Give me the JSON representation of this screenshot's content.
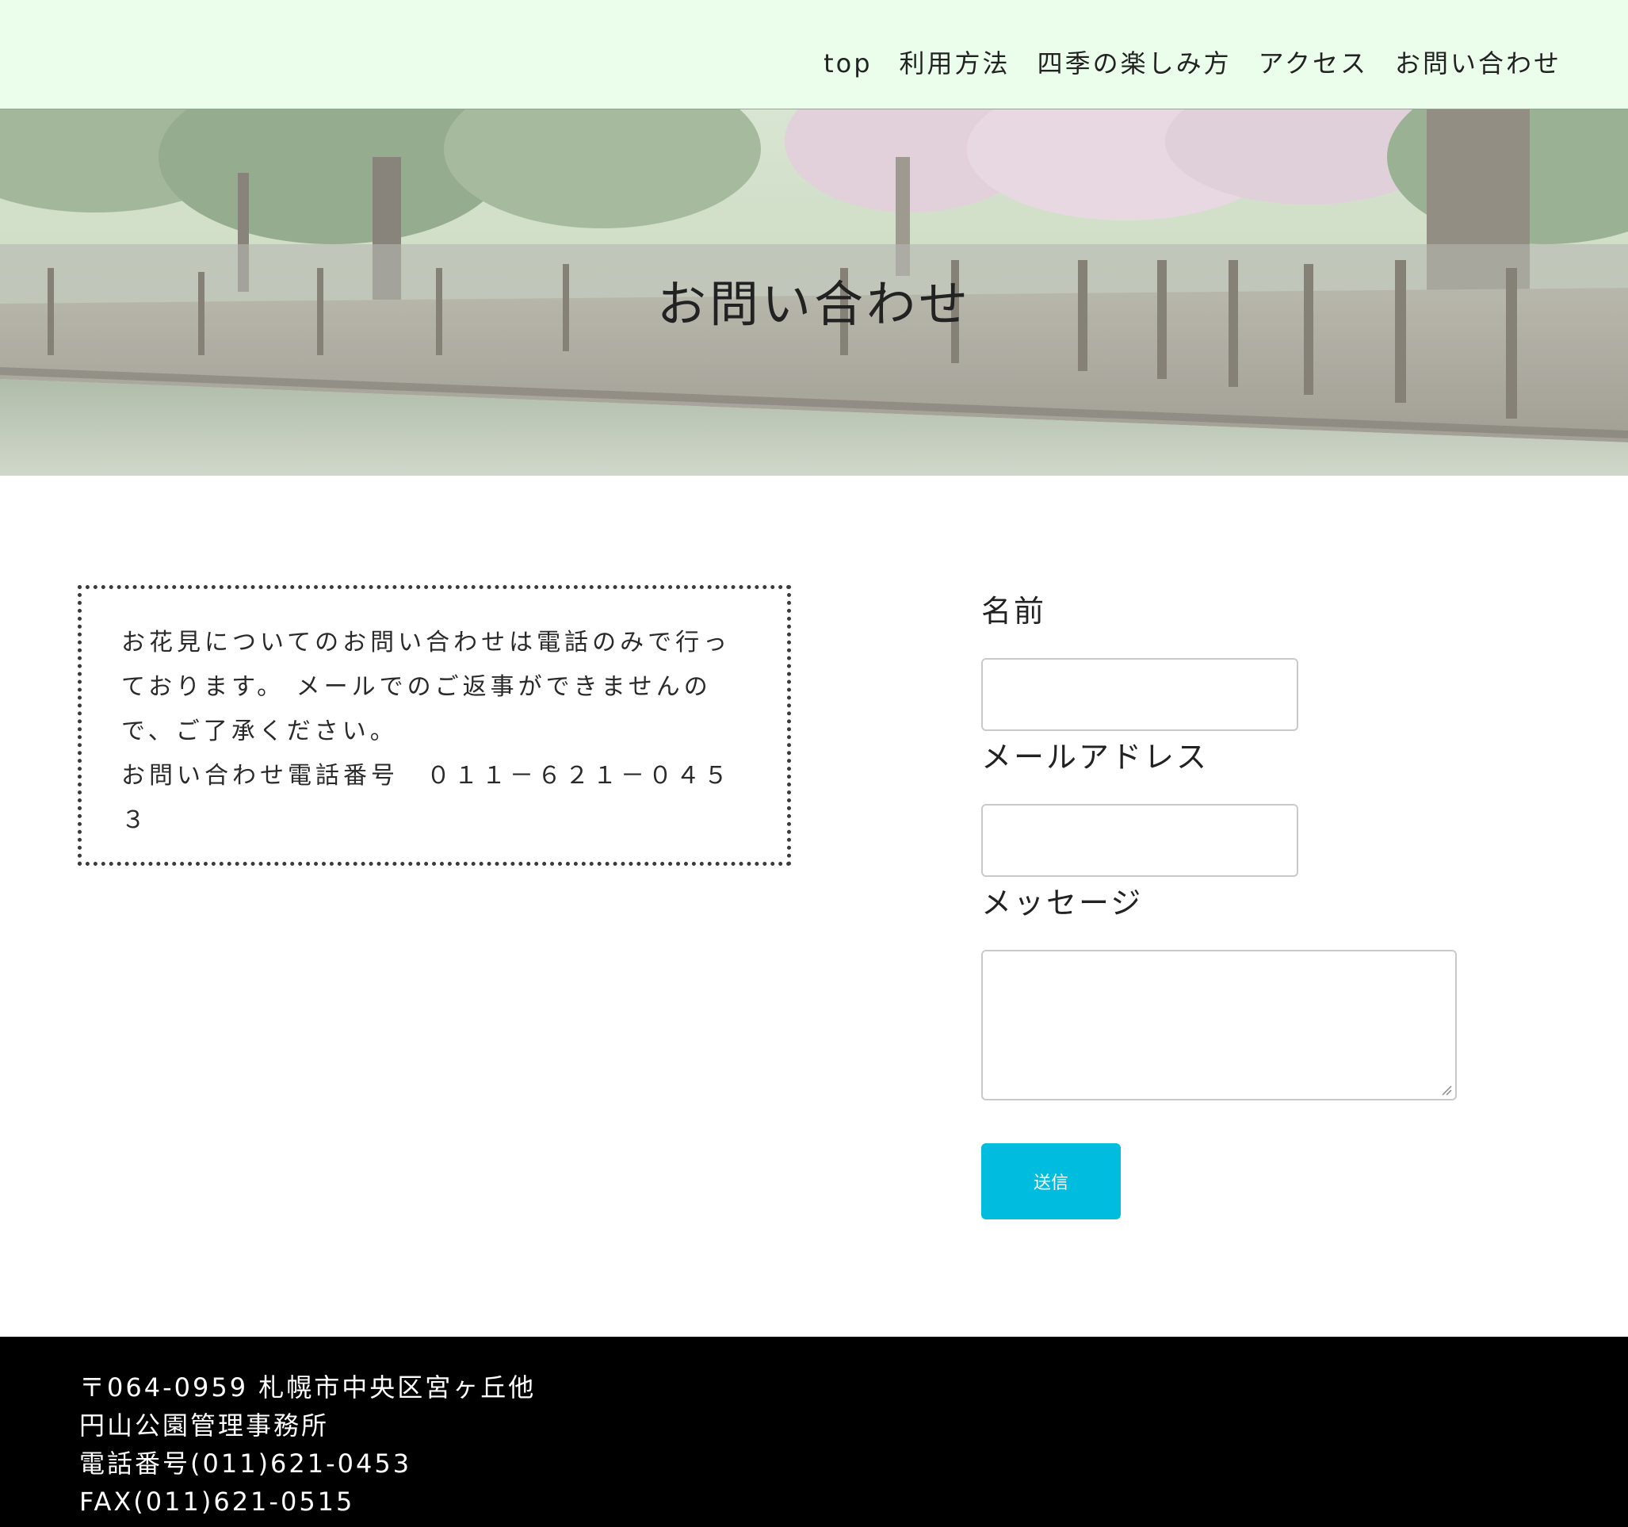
{
  "nav": {
    "items": [
      "top",
      "利用方法",
      "四季の楽しみ方",
      "アクセス",
      "お問い合わせ"
    ]
  },
  "hero": {
    "title": "お問い合わせ"
  },
  "notice": {
    "lines": [
      "お花見についてのお問い合わせは電話のみで行っ",
      "ております。 メールでのご返事ができませんの",
      "で、ご了承ください。",
      "お問い合わせ電話番号　０１１－６２１－０４５",
      "３"
    ]
  },
  "form": {
    "name_label": "名前",
    "email_label": "メールアドレス",
    "message_label": "メッセージ",
    "submit_label": "送信"
  },
  "footer": {
    "address": "〒064-0959 札幌市中央区宮ヶ丘他",
    "office": "円山公園管理事務所",
    "phone": "電話番号(011)621-0453",
    "fax": "FAX(011)621-0515"
  },
  "colors": {
    "header_bg": "#ebfdeb",
    "submit_bg": "#00bde0",
    "footer_bg": "#000000"
  }
}
